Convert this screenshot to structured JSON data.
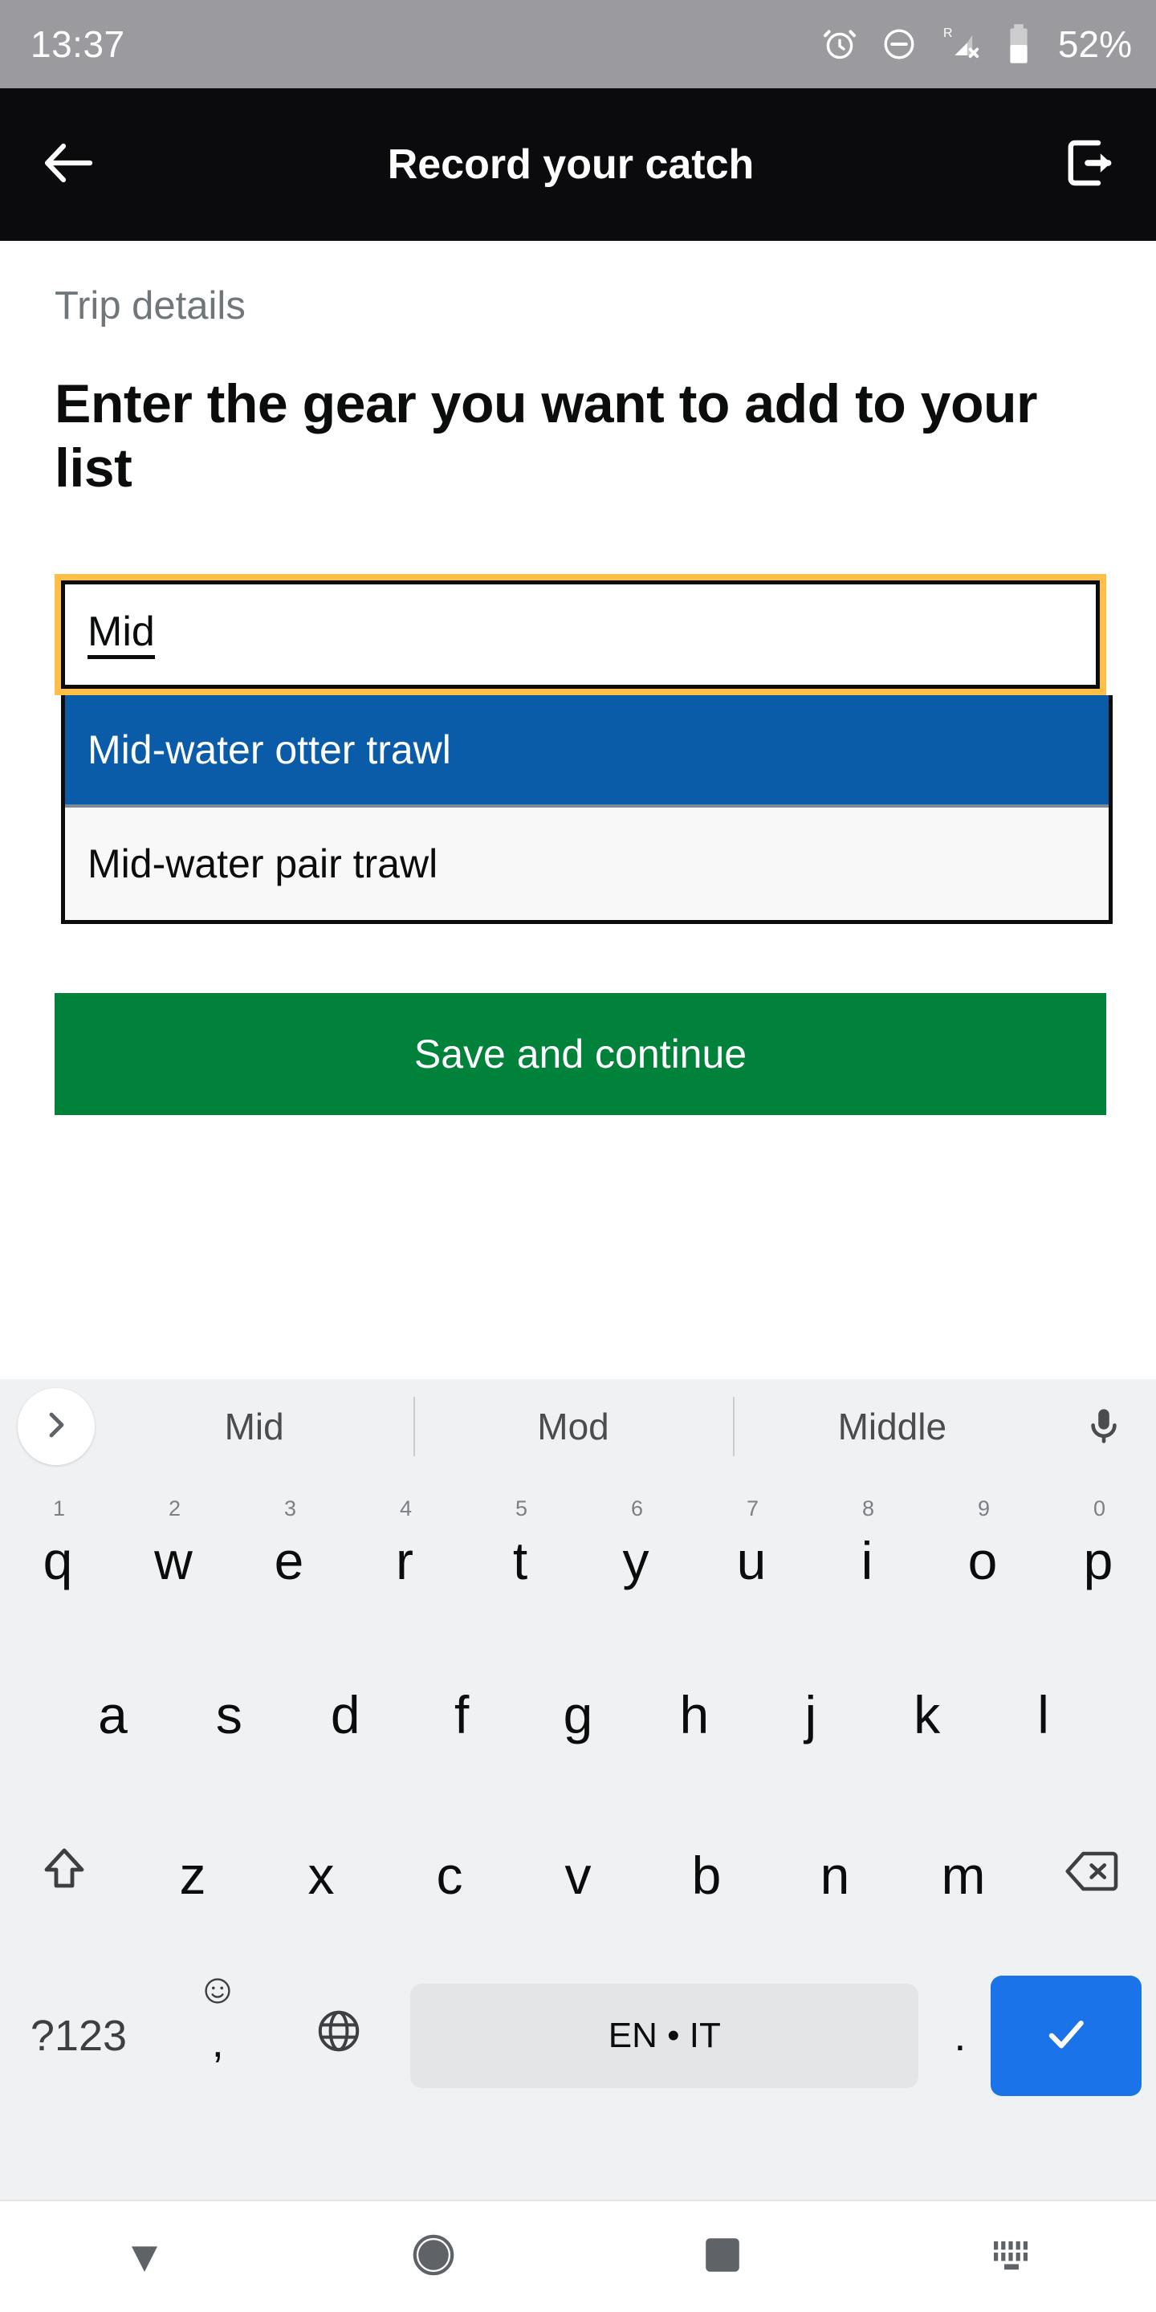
{
  "status_bar": {
    "clock": "13:37",
    "battery_percent": "52%",
    "icons": [
      "alarm-icon",
      "do-not-disturb-icon",
      "signal-no-service-icon",
      "battery-icon"
    ],
    "roaming_label": "R",
    "background_color": "#9b9a9e"
  },
  "header": {
    "title": "Record your catch",
    "back_icon": "arrow-left-icon",
    "signout_icon": "sign-out-icon",
    "background_color": "#0b0b0d"
  },
  "content": {
    "caption": "Trip details",
    "heading": "Enter the gear you want to add to your list"
  },
  "gear_input": {
    "value": "Mid",
    "placeholder": "",
    "focus_ring_color": "#ffbf47",
    "border_color": "#0b0c0c"
  },
  "suggestions": {
    "selected_index": 0,
    "selected_color": "#0b5ca8",
    "options": [
      {
        "label": "Mid-water otter trawl"
      },
      {
        "label": "Mid-water pair trawl"
      }
    ]
  },
  "save_button": {
    "label": "Save and continue",
    "color": "#00823b"
  },
  "keyboard": {
    "background_color": "#eff1f3",
    "expand_icon": "chevron-right-icon",
    "mic_icon": "microphone-icon",
    "candidates": [
      "Mid",
      "Mod",
      "Middle"
    ],
    "row1": [
      {
        "letter": "q",
        "num": "1"
      },
      {
        "letter": "w",
        "num": "2"
      },
      {
        "letter": "e",
        "num": "3"
      },
      {
        "letter": "r",
        "num": "4"
      },
      {
        "letter": "t",
        "num": "5"
      },
      {
        "letter": "y",
        "num": "6"
      },
      {
        "letter": "u",
        "num": "7"
      },
      {
        "letter": "i",
        "num": "8"
      },
      {
        "letter": "o",
        "num": "9"
      },
      {
        "letter": "p",
        "num": "0"
      }
    ],
    "row2": [
      {
        "letter": "a"
      },
      {
        "letter": "s"
      },
      {
        "letter": "d"
      },
      {
        "letter": "f"
      },
      {
        "letter": "g"
      },
      {
        "letter": "h"
      },
      {
        "letter": "j"
      },
      {
        "letter": "k"
      },
      {
        "letter": "l"
      }
    ],
    "row3": [
      {
        "letter": "z"
      },
      {
        "letter": "x"
      },
      {
        "letter": "c"
      },
      {
        "letter": "v"
      },
      {
        "letter": "b"
      },
      {
        "letter": "n"
      },
      {
        "letter": "m"
      }
    ],
    "shift_icon": "shift-arrow-up-icon",
    "backspace_icon": "backspace-icon",
    "symbols_key_label": "?123",
    "comma_key_label": ",",
    "comma_key_sublabel": "☺",
    "language_icon": "globe-icon",
    "spacebar_label": "EN • IT",
    "period_key_label": ".",
    "enter_icon": "check-icon",
    "enter_color": "#1a73e8"
  },
  "nav_bar": {
    "back_icon": "triangle-down-icon",
    "home_icon": "circle-icon",
    "recents_icon": "square-icon",
    "keyboard_switch_icon": "keyboard-switch-icon"
  }
}
